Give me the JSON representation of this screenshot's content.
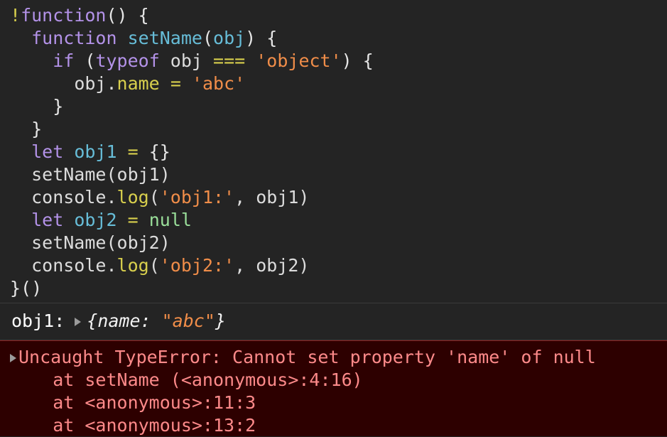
{
  "editor": {
    "code_lines": [
      [
        {
          "t": "!",
          "c": "t-bang"
        },
        {
          "t": "function",
          "c": "t-kw"
        },
        {
          "t": "() {",
          "c": "t-punc"
        }
      ],
      [
        {
          "t": "  ",
          "c": "t-plain"
        },
        {
          "t": "function",
          "c": "t-kw"
        },
        {
          "t": " ",
          "c": "t-plain"
        },
        {
          "t": "setName",
          "c": "t-fn"
        },
        {
          "t": "(",
          "c": "t-punc"
        },
        {
          "t": "obj",
          "c": "t-var"
        },
        {
          "t": ") {",
          "c": "t-punc"
        }
      ],
      [
        {
          "t": "    ",
          "c": "t-plain"
        },
        {
          "t": "if",
          "c": "t-kw"
        },
        {
          "t": " (",
          "c": "t-punc"
        },
        {
          "t": "typeof",
          "c": "t-kw"
        },
        {
          "t": " obj ",
          "c": "t-plain"
        },
        {
          "t": "===",
          "c": "t-op"
        },
        {
          "t": " ",
          "c": "t-plain"
        },
        {
          "t": "'object'",
          "c": "t-str"
        },
        {
          "t": ") {",
          "c": "t-punc"
        }
      ],
      [
        {
          "t": "      ",
          "c": "t-plain"
        },
        {
          "t": "obj",
          "c": "t-plain"
        },
        {
          "t": ".",
          "c": "t-plain"
        },
        {
          "t": "name",
          "c": "t-prop"
        },
        {
          "t": " ",
          "c": "t-plain"
        },
        {
          "t": "=",
          "c": "t-op"
        },
        {
          "t": " ",
          "c": "t-plain"
        },
        {
          "t": "'abc'",
          "c": "t-str"
        }
      ],
      [
        {
          "t": "    }",
          "c": "t-punc"
        }
      ],
      [
        {
          "t": "  }",
          "c": "t-punc"
        }
      ],
      [
        {
          "t": "  ",
          "c": "t-plain"
        },
        {
          "t": "let",
          "c": "t-kw"
        },
        {
          "t": " ",
          "c": "t-plain"
        },
        {
          "t": "obj1",
          "c": "t-var"
        },
        {
          "t": " ",
          "c": "t-plain"
        },
        {
          "t": "=",
          "c": "t-op"
        },
        {
          "t": " ",
          "c": "t-plain"
        },
        {
          "t": "{}",
          "c": "t-punc"
        }
      ],
      [
        {
          "t": "  setName(obj1)",
          "c": "t-plain"
        }
      ],
      [
        {
          "t": "  console",
          "c": "t-plain"
        },
        {
          "t": ".",
          "c": "t-plain"
        },
        {
          "t": "log",
          "c": "t-method"
        },
        {
          "t": "(",
          "c": "t-plain"
        },
        {
          "t": "'obj1:'",
          "c": "t-str"
        },
        {
          "t": ", obj1)",
          "c": "t-plain"
        }
      ],
      [
        {
          "t": "  ",
          "c": "t-plain"
        },
        {
          "t": "let",
          "c": "t-kw"
        },
        {
          "t": " ",
          "c": "t-plain"
        },
        {
          "t": "obj2",
          "c": "t-var"
        },
        {
          "t": " ",
          "c": "t-plain"
        },
        {
          "t": "=",
          "c": "t-op"
        },
        {
          "t": " ",
          "c": "t-plain"
        },
        {
          "t": "null",
          "c": "t-null"
        }
      ],
      [
        {
          "t": "  setName(obj2)",
          "c": "t-plain"
        }
      ],
      [
        {
          "t": "  console",
          "c": "t-plain"
        },
        {
          "t": ".",
          "c": "t-plain"
        },
        {
          "t": "log",
          "c": "t-method"
        },
        {
          "t": "(",
          "c": "t-plain"
        },
        {
          "t": "'obj2:'",
          "c": "t-str"
        },
        {
          "t": ", obj2)",
          "c": "t-plain"
        }
      ],
      [
        {
          "t": "}()",
          "c": "t-punc"
        }
      ]
    ]
  },
  "console": {
    "log_entry": {
      "label": "obj1:",
      "disclosure_icon": "triangle-right-icon",
      "object_prefix": "{name: ",
      "object_value": "\"abc\"",
      "object_suffix": "}"
    },
    "error_entry": {
      "disclosure_icon": "triangle-right-icon",
      "message": "Uncaught TypeError: Cannot set property 'name' of null",
      "stack": [
        "    at setName (<anonymous>:4:16)",
        "    at <anonymous>:11:3",
        "    at <anonymous>:13:2"
      ]
    }
  },
  "colors": {
    "background": "#242424",
    "error_background": "#2d0000",
    "error_border": "#8b1a1a",
    "error_text": "#fd8a8a",
    "keyword": "#b392e8",
    "function": "#67bdd8",
    "string": "#f08d49",
    "operator": "#d8cf4d",
    "null_literal": "#9adf9a",
    "plain_text": "#dcdcdc",
    "divider": "#3b3b3b"
  }
}
